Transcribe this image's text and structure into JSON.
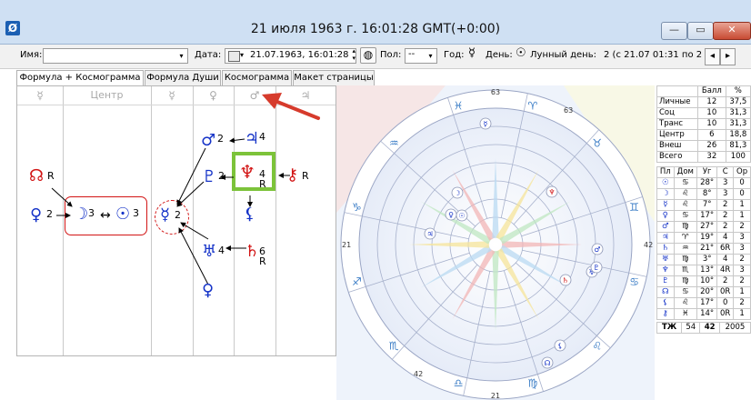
{
  "window": {
    "title": "21 июля 1963 г. 16:01:28 GMT(+0:00)",
    "app_icon_glyph": "Ø",
    "minimize_glyph": "—",
    "maximize_glyph": "▭",
    "close_glyph": "✕"
  },
  "toolbar": {
    "name_label": "Имя:",
    "name_value": "",
    "date_label": "Дата:",
    "date_value": "21.07.1963, 16:01:28",
    "gender_label": "Пол:",
    "gender_value": "--",
    "year_label": "Год:",
    "year_glyph": "☿",
    "day_label": "День:",
    "day_glyph": "☉",
    "lunar_label": "Лунный день:",
    "lunar_value": "2 (с 21.07 01:31 по 2",
    "nav_prev": "◂",
    "nav_next": "▸",
    "dropdown_glyph": "▾",
    "spin_up": "▴",
    "spin_down": "▾"
  },
  "tabs": [
    {
      "label": "Формула + Космограмма",
      "active": true
    },
    {
      "label": "Формула Души",
      "active": false
    },
    {
      "label": "Космограмма",
      "active": false
    },
    {
      "label": "Макет страницы",
      "active": false
    }
  ],
  "formula": {
    "headers": [
      "☿",
      "Центр",
      "☿",
      "♀",
      "♂",
      "♃"
    ],
    "nodes": {
      "node_glyph": "☊",
      "node_r": "R",
      "venus1": "♀",
      "venus1_n": "2",
      "moon": "☽",
      "moon_n": "3",
      "sun": "☉",
      "sun_n": "3",
      "arrows_double": "↔",
      "mercury": "☿",
      "mercury_n": "2",
      "mars": "♂",
      "mars_n": "2",
      "jupiter": "♃",
      "jupiter_n": "4",
      "pluto": "♇",
      "pluto_n": "2",
      "neptune": "♆",
      "neptune_n": "4",
      "neptune_r": "R",
      "chiron": "⚷",
      "chiron_r": "R",
      "lilith": "⚸",
      "uranus": "♅",
      "uranus_n": "4",
      "saturn": "♄",
      "saturn_n": "6",
      "saturn_r": "R",
      "venus2": "♀"
    }
  },
  "colors": {
    "blue": "#1533c8",
    "red": "#d21515",
    "highlight": "#7cc33a",
    "arrow": "#d63b2c"
  },
  "wheel": {
    "degree_labels": [
      "63",
      "21",
      "21",
      "42",
      "63",
      "42"
    ],
    "signs": [
      "♈",
      "♉",
      "♊",
      "♋",
      "♌",
      "♍",
      "♎",
      "♏",
      "♐",
      "♑",
      "♒",
      "♓"
    ],
    "planets": [
      "☉",
      "☽",
      "☿",
      "♀",
      "♂",
      "♃",
      "♄",
      "♅",
      "♆",
      "♇",
      "☊",
      "⚸"
    ]
  },
  "stats": {
    "head": [
      "",
      "Балл",
      "%"
    ],
    "rows": [
      [
        "Личные",
        "12",
        "37,5"
      ],
      [
        "Соц",
        "10",
        "31,3"
      ],
      [
        "Транс",
        "10",
        "31,3"
      ],
      [
        "Центр",
        "6",
        "18,8"
      ],
      [
        "Внеш",
        "26",
        "81,3"
      ],
      [
        "Всего",
        "32",
        "100"
      ]
    ]
  },
  "planet_table": {
    "head": [
      "Пл",
      "Дом",
      "Уг",
      "С",
      "Ор"
    ],
    "rows": [
      [
        "☉",
        "♋",
        "28°",
        "3",
        "0"
      ],
      [
        "☽",
        "♌",
        "8°",
        "3",
        "0"
      ],
      [
        "☿",
        "♌",
        "7°",
        "2",
        "1"
      ],
      [
        "♀",
        "♋",
        "17°",
        "2",
        "1"
      ],
      [
        "♂",
        "♍",
        "27°",
        "2",
        "2"
      ],
      [
        "♃",
        "♈",
        "19°",
        "4",
        "3"
      ],
      [
        "♄",
        "♒",
        "21°",
        "6R",
        "3"
      ],
      [
        "♅",
        "♍",
        "3°",
        "4",
        "2"
      ],
      [
        "♆",
        "♏",
        "13°",
        "4R",
        "3"
      ],
      [
        "♇",
        "♍",
        "10°",
        "2",
        "2"
      ],
      [
        "☊",
        "♋",
        "20°",
        "0R",
        "1"
      ],
      [
        "⚸",
        "♌",
        "17°",
        "0",
        "2"
      ],
      [
        "⚷",
        "♓",
        "14°",
        "0R",
        "1"
      ]
    ],
    "footer": [
      "ТЖ",
      "54",
      "42",
      "2005"
    ]
  }
}
